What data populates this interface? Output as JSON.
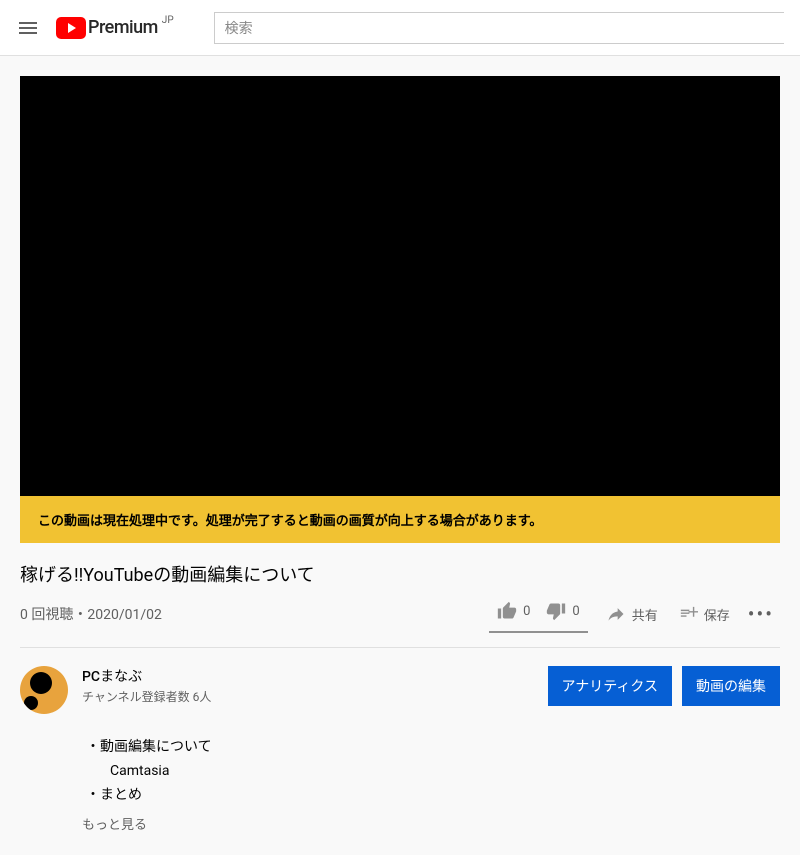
{
  "header": {
    "premium_label": "Premium",
    "region": "JP",
    "search_placeholder": "検索"
  },
  "banner": {
    "processing_msg": "この動画は現在処理中です。処理が完了すると動画の画質が向上する場合があります。"
  },
  "video": {
    "title": "稼げる!!YouTubeの動画編集について",
    "views_date": "0 回視聴・2020/01/02"
  },
  "actions": {
    "like_count": "0",
    "dislike_count": "0",
    "share_label": "共有",
    "save_label": "保存"
  },
  "channel": {
    "name": "PCまなぶ",
    "subscribers": "チャンネル登録者数 6人",
    "analytics_btn": "アナリティクス",
    "edit_btn": "動画の編集"
  },
  "description": {
    "line1": "・動画編集について",
    "line1_sub": "Camtasia",
    "line2": "・まとめ",
    "show_more": "もっと見る"
  }
}
